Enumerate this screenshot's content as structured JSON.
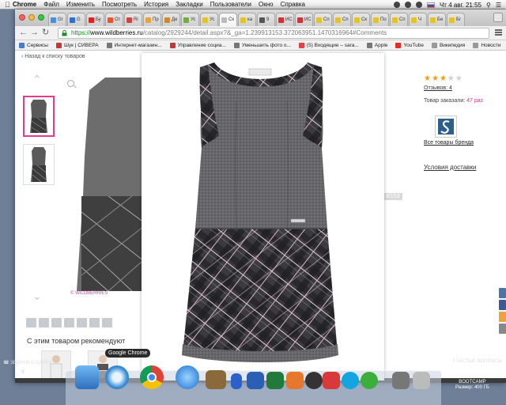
{
  "menubar": {
    "app": "Chrome",
    "items": [
      "Файл",
      "Изменить",
      "Посмотреть",
      "История",
      "Закладки",
      "Пользователи",
      "Окно",
      "Справка"
    ],
    "clock": "Чт 4 авг.  21:55"
  },
  "tabs": [
    {
      "label": "Gr",
      "color": "#4a90d9"
    },
    {
      "label": "G",
      "color": "#2f6fd1"
    },
    {
      "label": "Бу",
      "color": "#d22"
    },
    {
      "label": "От",
      "color": "#e4572e"
    },
    {
      "label": "Ri",
      "color": "#c44"
    },
    {
      "label": "Пр",
      "color": "#e8a33d"
    },
    {
      "label": "Де",
      "color": "#c83"
    },
    {
      "label": "Ус",
      "color": "#7a4"
    },
    {
      "label": "Ус",
      "color": "#e6c229"
    },
    {
      "label": "Ск",
      "color": "#bbb"
    },
    {
      "label": "ка",
      "color": "#e6c229"
    },
    {
      "label": "9",
      "color": "#555"
    },
    {
      "label": "ИС",
      "color": "#c33"
    },
    {
      "label": "ИС",
      "color": "#c33"
    },
    {
      "label": "Сп",
      "color": "#e6c229"
    },
    {
      "label": "Сп",
      "color": "#e6c229"
    },
    {
      "label": "Ск",
      "color": "#e6c229"
    },
    {
      "label": "По",
      "color": "#e6c229"
    },
    {
      "label": "Сп",
      "color": "#e6c229"
    },
    {
      "label": "Ч",
      "color": "#e6c229"
    },
    {
      "label": "Бе",
      "color": "#e6c229"
    },
    {
      "label": "Бг",
      "color": "#e6c229"
    }
  ],
  "address": {
    "https": "https://",
    "host": "www.wildberries.ru",
    "path": "/catalog/2929244/detail.aspx?&_ga=1.239913153.372063951.1470316964#Comments"
  },
  "bookmarks": [
    {
      "label": "Сервисы",
      "color": "#4a7bd0"
    },
    {
      "label": "Шук | СИВЕРА",
      "color": "#c33"
    },
    {
      "label": "Интернет-магазин...",
      "color": "#777"
    },
    {
      "label": "Управление социа...",
      "color": "#c33"
    },
    {
      "label": "Уменьшить фото о...",
      "color": "#777"
    },
    {
      "label": "(5) Входящие – sara...",
      "color": "#d44"
    },
    {
      "label": "Apple",
      "color": "#777"
    },
    {
      "label": "YouTube",
      "color": "#e52d27"
    },
    {
      "label": "Википедия",
      "color": "#999"
    },
    {
      "label": "Новости",
      "color": "#999"
    }
  ],
  "page": {
    "back_link": "Назад к списку товаров",
    "wb_mark": "© WILDBERRIES",
    "recommend_title": "С этим товаром рекомендуют",
    "reviews": "Отзывов: 4",
    "ordered_prefix": "Товар заказали: ",
    "ordered_count": "47 раз",
    "brand_link": "Все товары бренда",
    "delivery": "Условия доставки",
    "counter": "8/153",
    "rating": 3,
    "rating_max": 5,
    "callback": "ЗВОНОК С САЙТА",
    "faq": "ЧАСТЫЕ ВОПРОСЫ"
  },
  "dock": {
    "tooltip": "Google Chrome",
    "hdd_name": "BOOTCAMP",
    "hdd_size": "Размер: 400 ГБ"
  }
}
